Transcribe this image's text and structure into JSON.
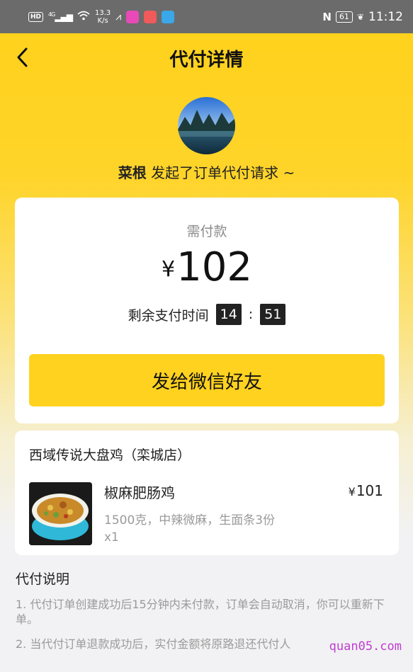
{
  "status_bar": {
    "hd": "HD",
    "network": "4G",
    "speed_value": "13.3",
    "speed_unit": "K/s",
    "nfc": "N",
    "battery": "61",
    "time": "11:12"
  },
  "header": {
    "title": "代付详情",
    "back_icon": "chevron-left-icon"
  },
  "requester": {
    "name": "菜根",
    "message": "发起了订单代付请求 ~"
  },
  "payment": {
    "label": "需付款",
    "currency": "¥",
    "amount": "102",
    "time_label": "剩余支付时间",
    "minutes": "14",
    "separator": ":",
    "seconds": "51",
    "send_button": "发给微信好友"
  },
  "order": {
    "shop": "西域传说大盘鸡（栾城店）",
    "item": {
      "name": "椒麻肥肠鸡",
      "currency": "¥",
      "price": "101",
      "spec": "1500克，中辣微麻，生面条3份",
      "qty": "x1"
    }
  },
  "info": {
    "title": "代付说明",
    "lines": [
      "1. 代付订单创建成功后15分钟内未付款，订单会自动取消，你可以重新下单。",
      "2. 当代付订单退款成功后，实付金额将原路退还代付人"
    ]
  },
  "watermark": "quan05.com",
  "colors": {
    "accent": "#ffd21f",
    "timer_bg": "#222222",
    "watermark": "#c03cd0"
  }
}
